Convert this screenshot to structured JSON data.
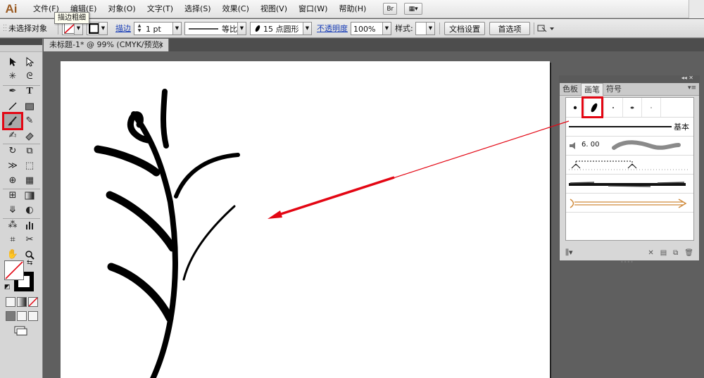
{
  "app": {
    "logo": "Ai"
  },
  "menu": {
    "items": [
      "文件(F)",
      "编辑(E)",
      "对象(O)",
      "文字(T)",
      "选择(S)",
      "效果(C)",
      "视图(V)",
      "窗口(W)",
      "帮助(H)"
    ],
    "bridge_label": "Br",
    "tooltip": "描边粗细"
  },
  "control": {
    "selection_status": "未选择对象",
    "stroke_link": "描边",
    "stroke_weight": "1 pt",
    "profile": "等比",
    "brush": "15 点圆形",
    "opacity_link": "不透明度",
    "opacity_value": "100%",
    "style_label": "样式:",
    "doc_setup_button": "文档设置",
    "preferences_button": "首选项"
  },
  "document": {
    "tab_title": "未标题-1* @ 99% (CMYK/预览)",
    "tab_close": "×"
  },
  "brushes_panel": {
    "tabs": [
      "色板",
      "画笔",
      "符号"
    ],
    "active_tab": "画笔",
    "basic_label": "基本",
    "brush_size_label": "6. 00"
  },
  "colors": {
    "highlight_red": "#e30613",
    "link_blue": "#1a3fb8",
    "panel_gray": "#d7d7d7",
    "workspace_gray": "#5f5f5f"
  },
  "icons": {
    "selected_tool": "paintbrush-icon",
    "selected_brush": "calligraphic-oval-brush-icon"
  }
}
